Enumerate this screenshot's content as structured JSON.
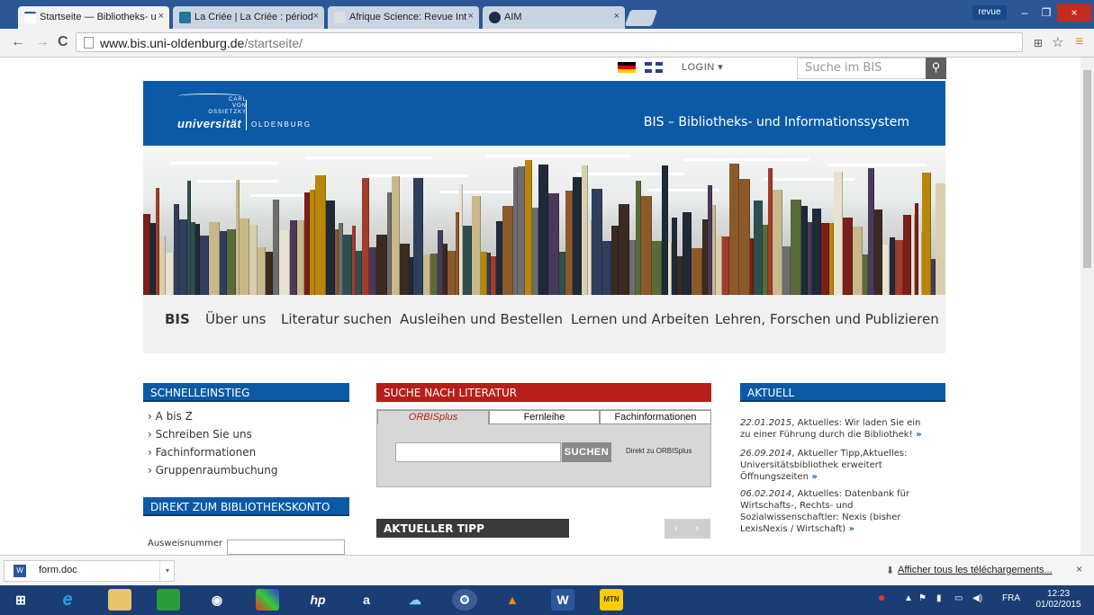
{
  "browser": {
    "tabs": [
      {
        "title": "Startseite — Bibliotheks- u",
        "active": true
      },
      {
        "title": "La Criée | La Criée : périod",
        "active": false
      },
      {
        "title": "Afrique Science: Revue Int",
        "active": false
      },
      {
        "title": "AIM",
        "active": false
      }
    ],
    "profile": "revue",
    "url_host": "www.bis.uni-oldenburg.de",
    "url_path": "/startseite/"
  },
  "page": {
    "login": "LOGIN ▾",
    "search_placeholder": "Suche im BIS",
    "logo": {
      "line1": "CARL",
      "line2": "VON",
      "line3": "OSSIETZKY",
      "uni": "universität",
      "city": "OLDENBURG"
    },
    "header_title": "BIS – Bibliotheks- und Informationssystem",
    "nav": [
      "BIS",
      "Über uns",
      "Literatur suchen",
      "Ausleihen und Bestellen",
      "Lernen und Arbeiten",
      "Lehren, Forschen und Publizieren"
    ],
    "schnelleinstieg": {
      "title": "SCHNELLEINSTIEG",
      "items": [
        "› A bis Z",
        "› Schreiben Sie uns",
        "› Fachinformationen",
        "› Gruppenraumbuchung"
      ]
    },
    "konto": {
      "title": "DIREKT ZUM BIBLIOTHEKSKONTO",
      "label": "Ausweisnummer"
    },
    "literatur": {
      "title": "SUCHE NACH LITERATUR",
      "tabs": [
        "ORBISplus",
        "Fernleihe",
        "Fachinformationen"
      ],
      "button": "SUCHEN",
      "direct": "Direkt zu ORBISplus"
    },
    "tipp": {
      "title": "AKTUELLER TIPP",
      "prev": "‹",
      "next": "›"
    },
    "aktuell": {
      "title": "AKTUELL",
      "items": [
        {
          "date": "22.01.2015",
          "text": ", Aktuelles: Wir laden Sie ein zu einer Führung durch die Bibliothek!",
          "more": " »"
        },
        {
          "date": "26.09.2014",
          "text": ", Aktueller Tipp,Aktuelles: Universitätsbibliothek erweitert Öffnungszeiten",
          "more": " »"
        },
        {
          "date": "06.02.2014",
          "text": ", Aktuelles: Datenbank für Wirtschafts-, Rechts- und Sozialwissenschaftler: Nexis (bisher LexisNexis / Wirtschaft)",
          "more": " »"
        }
      ]
    }
  },
  "downloads": {
    "file": "form.doc",
    "show_all": "Afficher tous les téléchargements...",
    "close": "×"
  },
  "taskbar": {
    "lang": "FRA",
    "time": "12:23",
    "date": "01/02/2015"
  },
  "colors": {
    "brand_blue": "#0c5aa6",
    "brand_red": "#b51f18"
  }
}
